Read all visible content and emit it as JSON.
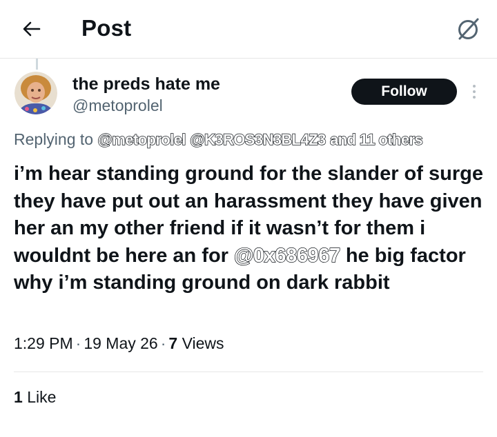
{
  "header": {
    "title": "Post",
    "back_icon": "arrow-left-icon",
    "grok_icon": "grok-icon"
  },
  "author": {
    "display_name": "the preds hate me",
    "handle": "@metoprolel",
    "follow_label": "Follow"
  },
  "reply": {
    "prefix": "Replying to",
    "mentions": [
      "@metoprolel",
      "@K3ROS3N3BL4Z3"
    ],
    "others": "and 11 others"
  },
  "tweet": {
    "text_before": "i’m hear standing ground for the slander of surge they have put out an harassment they have given her an my other friend if it wasn’t for them i wouldnt be here an for",
    "mention": "@0x686967",
    "text_after": "he big factor why i’m standing ground on dark rabbit"
  },
  "meta": {
    "time": "1:29 PM",
    "date": "19 May 26",
    "views_count": "7",
    "views_label": "Views"
  },
  "stats": {
    "likes_count": "1",
    "likes_label": "Like"
  }
}
